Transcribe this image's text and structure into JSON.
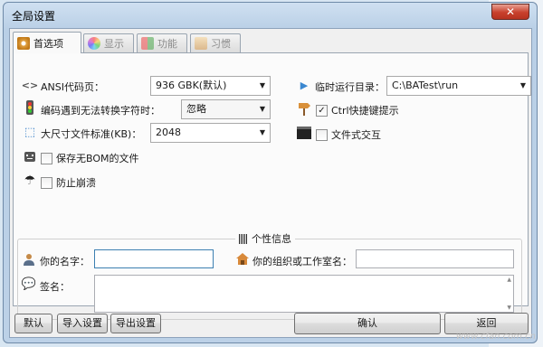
{
  "window": {
    "title": "全局设置",
    "close_symbol": "✕"
  },
  "tabs": [
    {
      "label": "首选项",
      "icon": "gear-icon"
    },
    {
      "label": "显示",
      "icon": "color-wheel-icon"
    },
    {
      "label": "功能",
      "icon": "blocks-icon"
    },
    {
      "label": "习惯",
      "icon": "box-icon"
    }
  ],
  "prefs": {
    "codepage_label": "ANSI代码页：",
    "codepage_value": "936 GBK(默认)",
    "unconvertible_label": "编码遇到无法转换字符时：",
    "unconvertible_value": "忽略",
    "large_file_label": "大尺寸文件标准(KB)：",
    "large_file_value": "2048",
    "save_no_bom_label": "保存无BOM的文件",
    "prevent_crash_label": "防止崩溃",
    "temp_dir_label": "临时运行目录：",
    "temp_dir_value": "C:\\BATest\\run",
    "ctrl_hint_label": "Ctrl快捷键提示",
    "ctrl_hint_checked": "✓",
    "file_interact_label": "文件式交互"
  },
  "personal": {
    "group_title": "个性信息",
    "name_label": "你的名字：",
    "org_label": "你的组织或工作室名：",
    "sign_label": "签名："
  },
  "buttons": {
    "default": "默认",
    "import": "导入设置",
    "export": "导出设置",
    "ok": "确认",
    "back": "返回"
  },
  "watermark": "www.cfan.com.cn"
}
